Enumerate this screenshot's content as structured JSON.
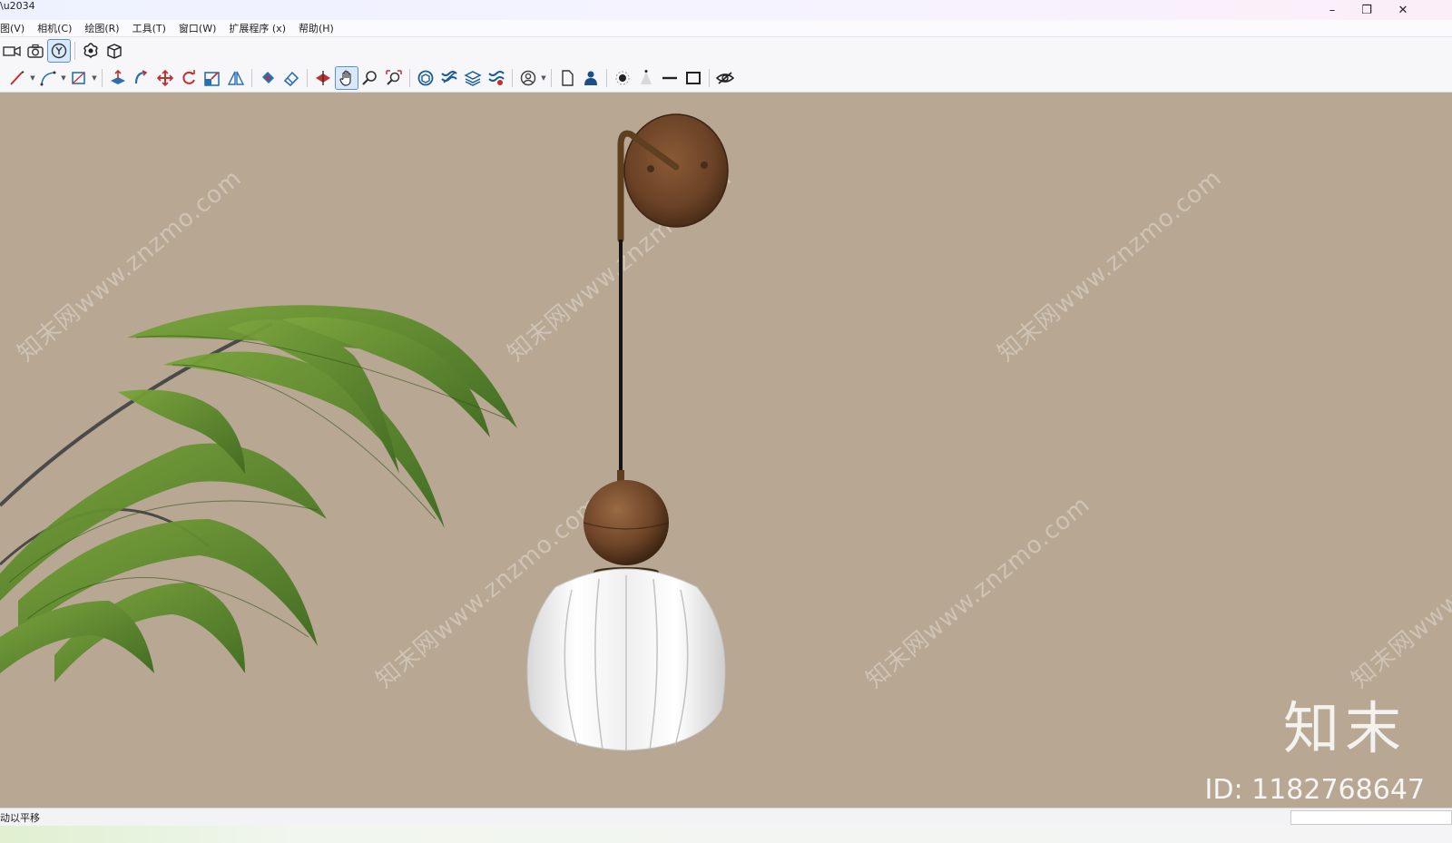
{
  "titlebar": {
    "mark": "\\u2034",
    "minimize": "–",
    "restore": "❐",
    "close": "✕"
  },
  "menu": [
    "图(V)",
    "相机(C)",
    "绘图(R)",
    "工具(T)",
    "窗口(W)",
    "扩展程序 (x)",
    "帮助(H)"
  ],
  "toolbar1": {
    "icons": [
      "video-camera-icon",
      "photo-camera-icon",
      "walk-orbit-icon",
      "gear-flower-icon",
      "cube-box-icon"
    ],
    "active_index": 2
  },
  "toolbar2": {
    "icons": [
      "pencil-icon",
      "arc-icon",
      "rectangle-icon",
      "push-pull-icon",
      "follow-me-icon",
      "move-icon",
      "rotate-icon",
      "scale-icon",
      "mirror-icon",
      "paint-bucket-icon",
      "eraser-icon",
      "section-plane-icon",
      "pan-icon",
      "zoom-icon",
      "zoom-extents-icon",
      "component-icon",
      "layers-icon",
      "stack-icon",
      "tags-icon",
      "user-circle-icon",
      "page-icon",
      "person-icon",
      "dot-icon",
      "cone-icon",
      "line-icon",
      "square-icon",
      "eye-hidden-icon"
    ],
    "active_icon": "pan-icon"
  },
  "viewport": {
    "watermark_text": "知末网www.znzmo.com",
    "brand": "知末",
    "id_label": "ID: 1182768647",
    "background_color": "#b7a793"
  },
  "status": {
    "text": "动以平移"
  }
}
